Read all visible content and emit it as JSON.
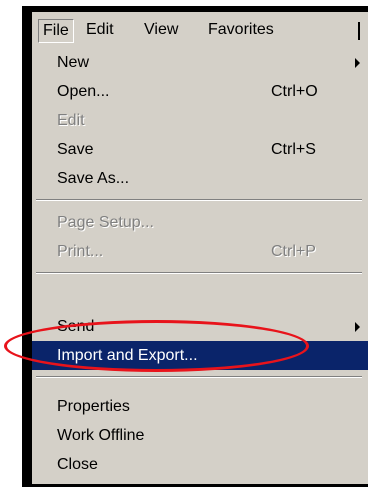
{
  "menubar": {
    "file": "File",
    "edit": "Edit",
    "view": "View",
    "favorites": "Favorites"
  },
  "file_menu": {
    "items": [
      {
        "label": "New",
        "shortcut": "",
        "enabled": true,
        "submenu": true
      },
      {
        "label": "Open...",
        "shortcut": "Ctrl+O",
        "enabled": true
      },
      {
        "label": "Edit",
        "shortcut": "",
        "enabled": false
      },
      {
        "label": "Save",
        "shortcut": "Ctrl+S",
        "enabled": true
      },
      {
        "label": "Save As...",
        "shortcut": "",
        "enabled": true
      },
      {
        "label": "Page Setup...",
        "shortcut": "",
        "enabled": false
      },
      {
        "label": "Print...",
        "shortcut": "Ctrl+P",
        "enabled": false
      },
      {
        "label": "Send",
        "shortcut": "",
        "enabled": true,
        "submenu": true
      },
      {
        "label": "Import and Export...",
        "shortcut": "",
        "enabled": true,
        "selected": true
      },
      {
        "label": "Properties",
        "shortcut": "",
        "enabled": true
      },
      {
        "label": "Work Offline",
        "shortcut": "",
        "enabled": true
      },
      {
        "label": "Close",
        "shortcut": "",
        "enabled": true
      }
    ]
  },
  "colors": {
    "menu_face": "#d4d0c8",
    "highlight": "#0a246a",
    "annotation": "#e8131b"
  }
}
